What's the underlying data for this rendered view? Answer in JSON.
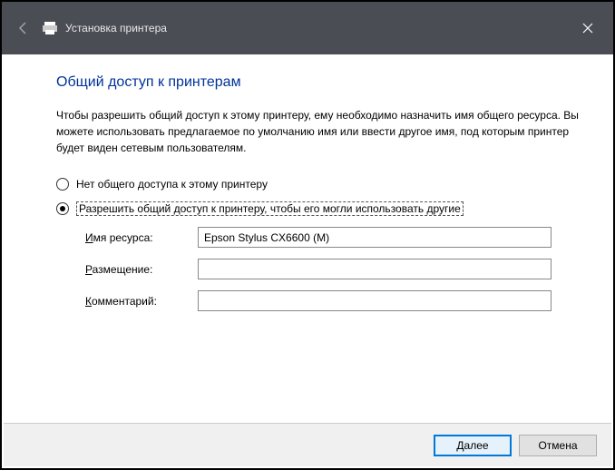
{
  "titlebar": {
    "title": "Установка принтера"
  },
  "content": {
    "heading": "Общий доступ к принтерам",
    "description": "Чтобы разрешить общий доступ к этому принтеру, ему необходимо назначить имя общего ресурса. Вы можете использовать предлагаемое по умолчанию имя или ввести другое имя, под которым принтер будет виден сетевым пользователям."
  },
  "radio": {
    "no_share": "Нет общего доступа к этому принтеру",
    "share": "Разрешить общий доступ к принтеру, чтобы его могли использовать другие"
  },
  "form": {
    "name_label_pre": "И",
    "name_label_post": "мя ресурса:",
    "name_value": "Epson Stylus CX6600 (M)",
    "location_label_pre": "Р",
    "location_label_post": "азмещение:",
    "location_value": "",
    "comment_label_pre": "К",
    "comment_label_post": "омментарий:",
    "comment_value": ""
  },
  "buttons": {
    "next_pre": "Д",
    "next_post": "алее",
    "cancel": "Отмена"
  }
}
